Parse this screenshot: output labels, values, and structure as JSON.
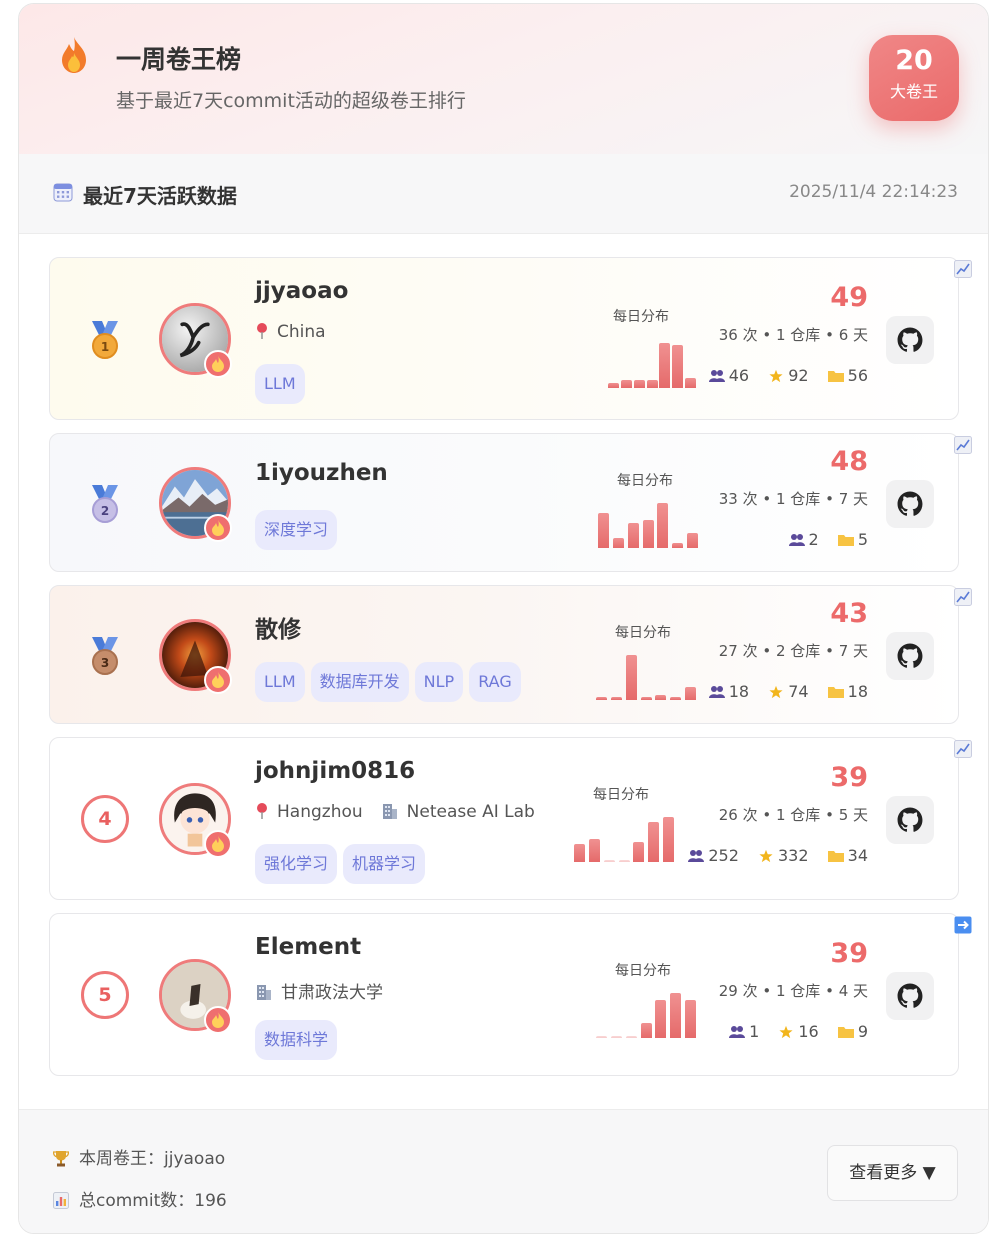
{
  "header": {
    "title": "一周卷王榜",
    "subtitle": "基于最近7天commit活动的超级卷王排行",
    "count": "20",
    "count_label": "大卷王",
    "icon": "flame-icon"
  },
  "section": {
    "title": "最近7天活跃数据",
    "timestamp": "2025/11/4 22:14:23",
    "icon": "calendar-icon"
  },
  "distribution_label": "每日分布",
  "users": [
    {
      "rank": "1",
      "medal": "gold",
      "name": "jjyaoao",
      "location": "China",
      "org": "",
      "tags": [
        "LLM"
      ],
      "score": "49",
      "commits": "36 次",
      "repos": "1 仓库",
      "days": "6 天",
      "followers": "46",
      "stars": "92",
      "projects": "56",
      "daily": [
        0.1,
        0.15,
        0.15,
        0.15,
        0.9,
        0.85,
        0.2
      ],
      "trend_icon": "chart-up-icon"
    },
    {
      "rank": "2",
      "medal": "silver",
      "name": "1iyouzhen",
      "location": "",
      "org": "",
      "tags": [
        "深度学习"
      ],
      "score": "48",
      "commits": "33 次",
      "repos": "1 仓库",
      "days": "7 天",
      "followers": "2",
      "stars": "",
      "projects": "5",
      "daily": [
        0.7,
        0.2,
        0.5,
        0.55,
        0.9,
        0.1,
        0.3
      ],
      "trend_icon": "chart-up-icon"
    },
    {
      "rank": "3",
      "medal": "bronze",
      "name": "散修",
      "location": "",
      "org": "",
      "tags": [
        "LLM",
        "数据库开发",
        "NLP",
        "RAG"
      ],
      "score": "43",
      "commits": "27 次",
      "repos": "2 仓库",
      "days": "7 天",
      "followers": "18",
      "stars": "74",
      "projects": "18",
      "daily": [
        0.05,
        0.05,
        0.9,
        0.05,
        0.1,
        0.05,
        0.25
      ],
      "trend_icon": "chart-up-icon"
    },
    {
      "rank": "4",
      "medal": "",
      "name": "johnjim0816",
      "location": "Hangzhou",
      "org": "Netease AI Lab",
      "tags": [
        "强化学习",
        "机器学习"
      ],
      "score": "39",
      "commits": "26 次",
      "repos": "1 仓库",
      "days": "5 天",
      "followers": "252",
      "stars": "332",
      "projects": "34",
      "daily": [
        0.35,
        0.45,
        0.0,
        0.0,
        0.4,
        0.8,
        0.9
      ],
      "trend_icon": "chart-up-icon"
    },
    {
      "rank": "5",
      "medal": "",
      "name": "Element",
      "location": "",
      "org": "甘肃政法大学",
      "tags": [
        "数据科学"
      ],
      "score": "39",
      "commits": "29 次",
      "repos": "1 仓库",
      "days": "4 天",
      "followers": "1",
      "stars": "16",
      "projects": "9",
      "daily": [
        0.02,
        0.02,
        0.02,
        0.3,
        0.75,
        0.9,
        0.75
      ],
      "trend_icon": "arrow-right-icon"
    }
  ],
  "footer": {
    "king_label": "本周卷王：",
    "king_name": "jjyaoao",
    "total_label": "总commit数：",
    "total_value": "196",
    "more_button": "查看更多 ▼"
  },
  "colors": {
    "accent": "#ec6a6a",
    "tag_bg": "#e9eafc",
    "tag_text": "#6e78d8",
    "gold": "#f2a93b",
    "silver": "#b9b2dc",
    "bronze": "#c58d6b"
  }
}
